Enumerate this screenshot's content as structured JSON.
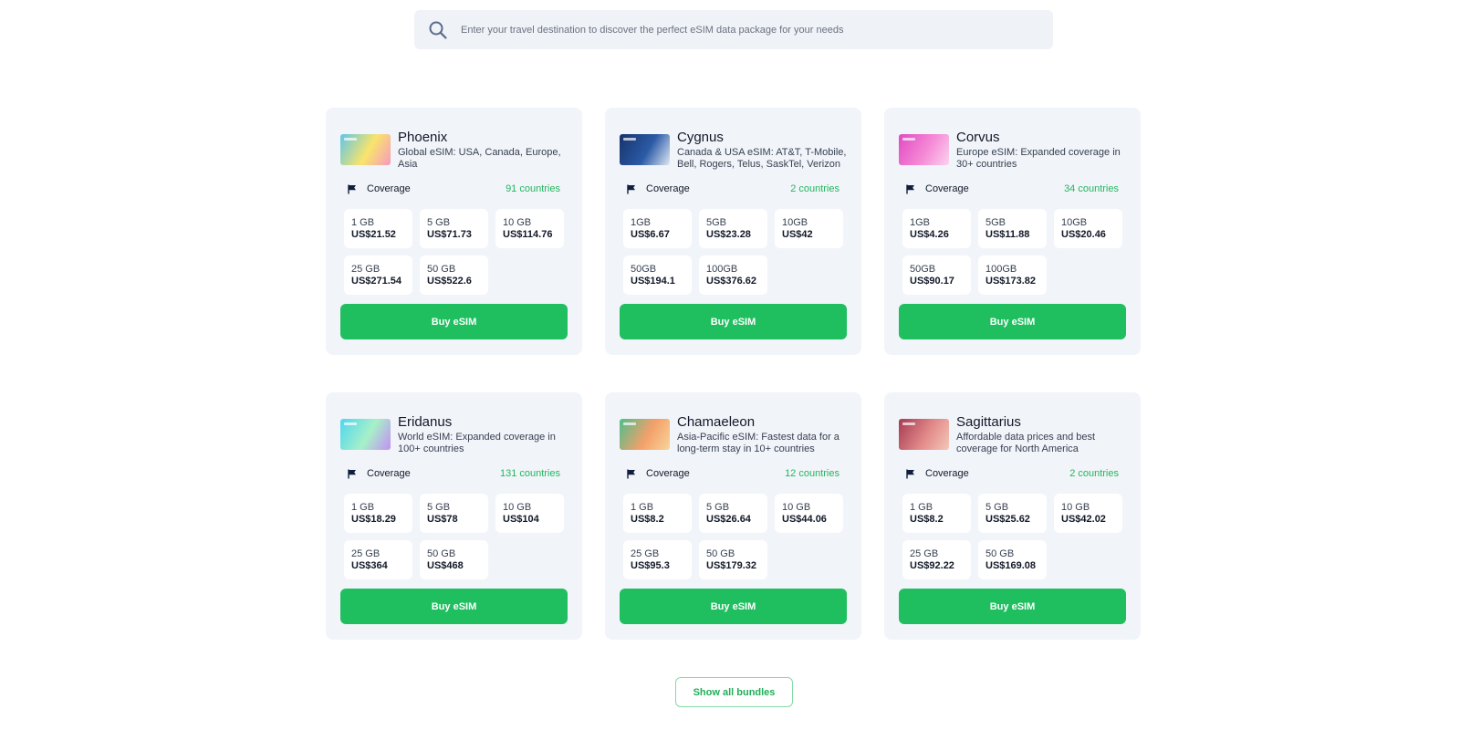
{
  "search": {
    "placeholder": "Enter your travel destination to discover the perfect eSIM data package for your needs"
  },
  "colors": {
    "accent": "#1fbe5f",
    "accent_text": "#22b75e",
    "card_bg": "#f1f4f9"
  },
  "cards": [
    {
      "title": "Phoenix",
      "desc": "Global eSIM: USA, Canada, Europe, Asia",
      "image_colors": [
        "#5ec6e8",
        "#f9e46b",
        "#f69ac0"
      ],
      "coverage_label": "Coverage",
      "coverage_value": "91 countries",
      "plans": [
        {
          "size": "1 GB",
          "price": "US$21.52"
        },
        {
          "size": "5 GB",
          "price": "US$71.73"
        },
        {
          "size": "10 GB",
          "price": "US$114.76"
        },
        {
          "size": "25 GB",
          "price": "US$271.54"
        },
        {
          "size": "50 GB",
          "price": "US$522.6"
        }
      ],
      "button": "Buy eSIM"
    },
    {
      "title": "Cygnus",
      "desc": "Canada & USA eSIM: AT&T, T-Mobile, Bell, Rogers, Telus, SaskTel, Verizon",
      "image_colors": [
        "#16336b",
        "#2b5aa6",
        "#dfe8f5"
      ],
      "coverage_label": "Coverage",
      "coverage_value": "2 countries",
      "plans": [
        {
          "size": "1GB",
          "price": "US$6.67"
        },
        {
          "size": "5GB",
          "price": "US$23.28"
        },
        {
          "size": "10GB",
          "price": "US$42"
        },
        {
          "size": "50GB",
          "price": "US$194.1"
        },
        {
          "size": "100GB",
          "price": "US$376.62"
        }
      ],
      "button": "Buy eSIM"
    },
    {
      "title": "Corvus",
      "desc": "Europe eSIM: Expanded coverage in 30+ countries",
      "image_colors": [
        "#e04bc2",
        "#f58ad6",
        "#fbd3ef"
      ],
      "coverage_label": "Coverage",
      "coverage_value": "34 countries",
      "plans": [
        {
          "size": "1GB",
          "price": "US$4.26"
        },
        {
          "size": "5GB",
          "price": "US$11.88"
        },
        {
          "size": "10GB",
          "price": "US$20.46"
        },
        {
          "size": "50GB",
          "price": "US$90.17"
        },
        {
          "size": "100GB",
          "price": "US$173.82"
        }
      ],
      "button": "Buy eSIM"
    },
    {
      "title": "Eridanus",
      "desc": "World eSIM: Expanded coverage in 100+ countries",
      "image_colors": [
        "#4fd6f0",
        "#a7f0c8",
        "#c48ff4"
      ],
      "coverage_label": "Coverage",
      "coverage_value": "131 countries",
      "plans": [
        {
          "size": "1 GB",
          "price": "US$18.29"
        },
        {
          "size": "5 GB",
          "price": "US$78"
        },
        {
          "size": "10 GB",
          "price": "US$104"
        },
        {
          "size": "25 GB",
          "price": "US$364"
        },
        {
          "size": "50 GB",
          "price": "US$468"
        }
      ],
      "button": "Buy eSIM"
    },
    {
      "title": "Chamaeleon",
      "desc": "Asia-Pacific eSIM: Fastest data for a long-term stay in 10+ countries",
      "image_colors": [
        "#4fbe8c",
        "#f4a06a",
        "#f7d59a"
      ],
      "coverage_label": "Coverage",
      "coverage_value": "12 countries",
      "plans": [
        {
          "size": "1 GB",
          "price": "US$8.2"
        },
        {
          "size": "5 GB",
          "price": "US$26.64"
        },
        {
          "size": "10 GB",
          "price": "US$44.06"
        },
        {
          "size": "25 GB",
          "price": "US$95.3"
        },
        {
          "size": "50 GB",
          "price": "US$179.32"
        }
      ],
      "button": "Buy eSIM"
    },
    {
      "title": "Sagittarius",
      "desc": "Affordable data prices and best coverage for North America",
      "image_colors": [
        "#a63a52",
        "#e28a8a",
        "#f4c8b8"
      ],
      "coverage_label": "Coverage",
      "coverage_value": "2 countries",
      "plans": [
        {
          "size": "1 GB",
          "price": "US$8.2"
        },
        {
          "size": "5 GB",
          "price": "US$25.62"
        },
        {
          "size": "10 GB",
          "price": "US$42.02"
        },
        {
          "size": "25 GB",
          "price": "US$92.22"
        },
        {
          "size": "50 GB",
          "price": "US$169.08"
        }
      ],
      "button": "Buy eSIM"
    }
  ],
  "show_all": "Show all bundles"
}
